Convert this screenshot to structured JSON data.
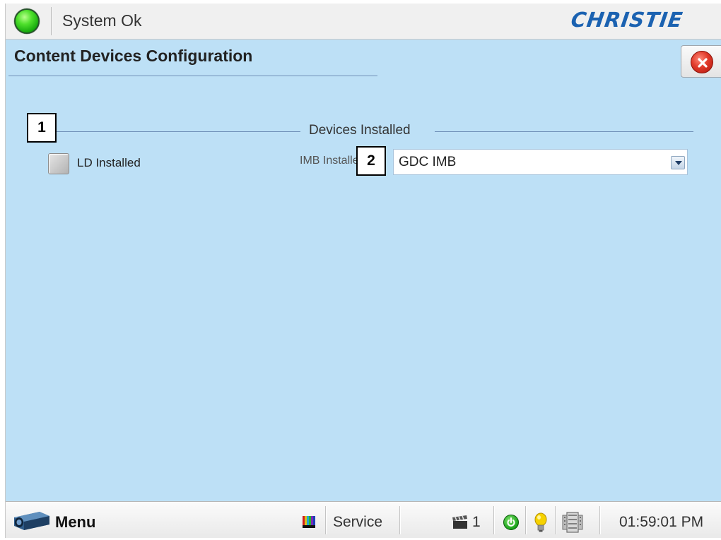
{
  "header": {
    "status_text": "System Ok",
    "logo_text": "CHRISTIE",
    "status_color": "#2ecc1a",
    "logo_color": "#1b62b1"
  },
  "page": {
    "title": "Content Devices Configuration",
    "close_icon": "close-icon"
  },
  "group": {
    "title": "Devices Installed",
    "ld_installed": {
      "label": "LD Installed",
      "checked": false
    },
    "imb_installed": {
      "label": "IMB Installed",
      "selected": "GDC IMB"
    }
  },
  "callouts": {
    "one": "1",
    "two": "2"
  },
  "taskbar": {
    "menu_label": "Menu",
    "service_label": "Service",
    "clapper_count": "1",
    "time": "01:59:01 PM",
    "icons": [
      "projector-icon",
      "test-pattern-icon",
      "clapper-icon",
      "power-icon",
      "lamp-bulb-icon",
      "film-reel-icon"
    ]
  },
  "colors": {
    "content_background": "#bde0f6",
    "accent_blue": "#1b62b1",
    "close_red": "#e03a2a"
  }
}
